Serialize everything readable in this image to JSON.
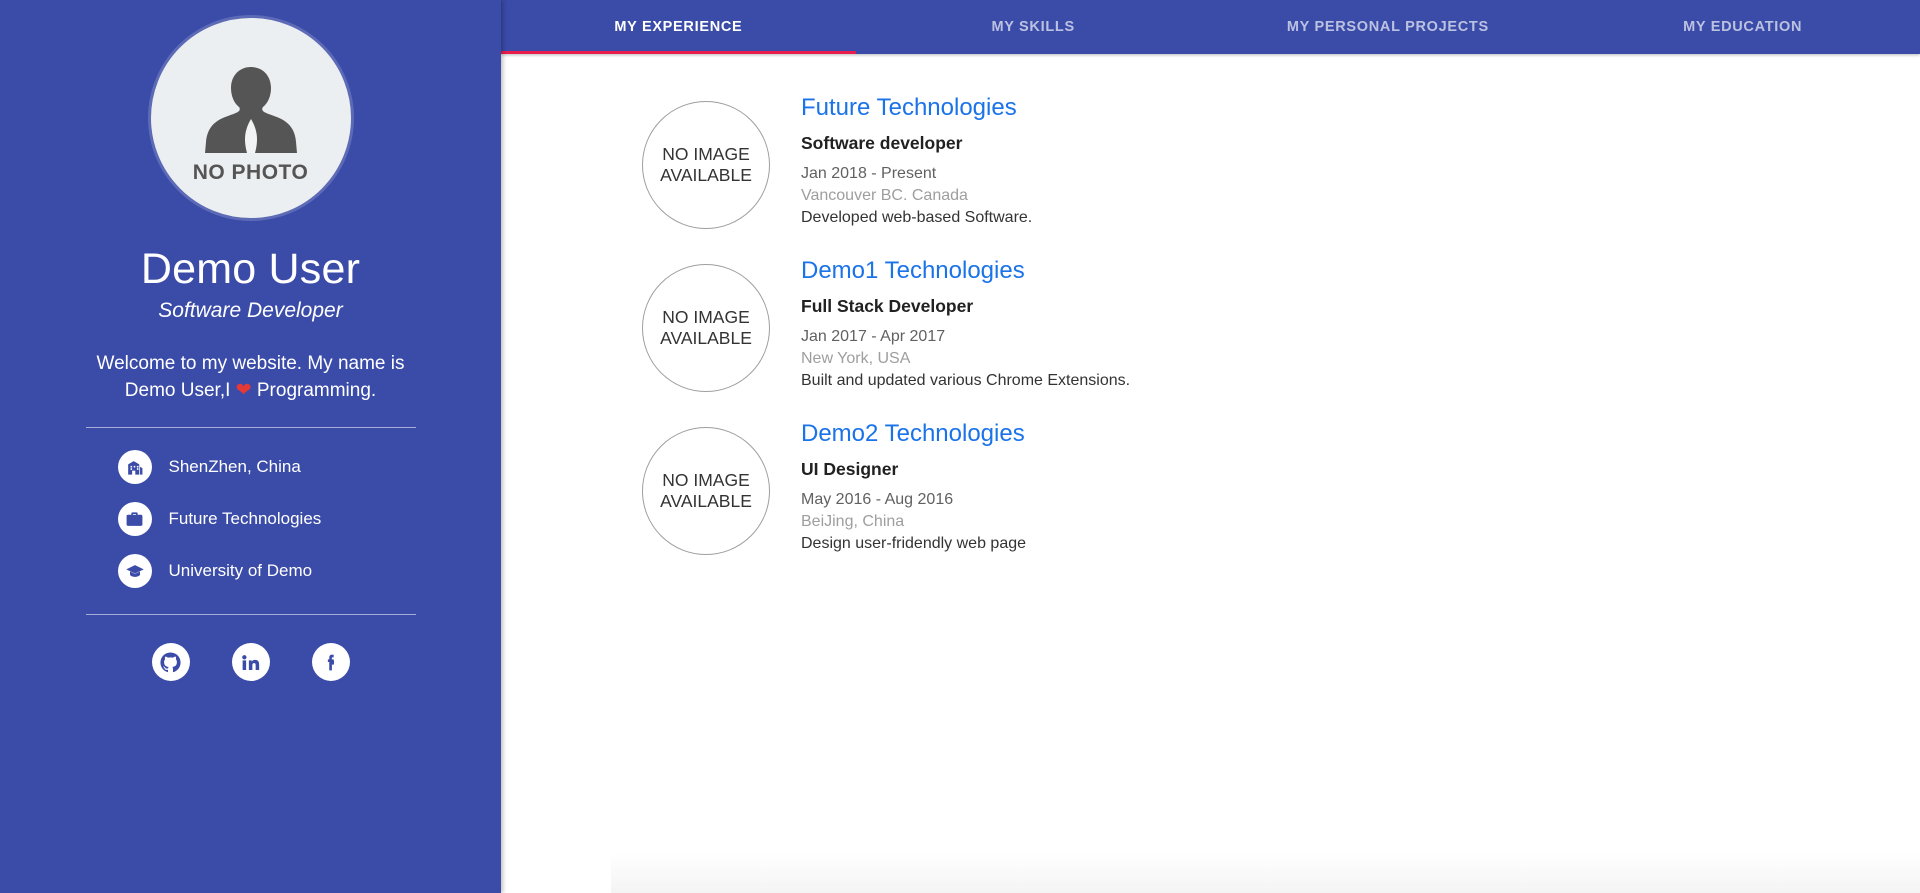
{
  "sidebar": {
    "avatar": {
      "placeholder_text": "NO PHOTO",
      "icon": "person-silhouette-icon"
    },
    "name": "Demo User",
    "role": "Software Developer",
    "bio_line1": "Welcome to my website. My name is",
    "bio_line2_before": "Demo User,I ",
    "bio_heart": "❤",
    "bio_line2_after": " Programming.",
    "info_items": [
      {
        "icon": "city-building-icon",
        "label": "ShenZhen, China"
      },
      {
        "icon": "briefcase-icon",
        "label": "Future Technologies"
      },
      {
        "icon": "graduation-cap-icon",
        "label": "University of Demo"
      }
    ],
    "social_items": [
      {
        "icon": "github-icon",
        "name": "GitHub"
      },
      {
        "icon": "linkedin-icon",
        "name": "LinkedIn"
      },
      {
        "icon": "facebook-icon",
        "name": "Facebook"
      }
    ]
  },
  "tabs": [
    {
      "label": "MY EXPERIENCE",
      "active": true
    },
    {
      "label": "MY SKILLS",
      "active": false
    },
    {
      "label": "MY PERSONAL PROJECTS",
      "active": false
    },
    {
      "label": "MY EDUCATION",
      "active": false
    }
  ],
  "experience": [
    {
      "logo_line1": "NO IMAGE",
      "logo_line2": "AVAILABLE",
      "company": "Future Technologies",
      "title": "Software developer",
      "dates": "Jan 2018 - Present",
      "location": "Vancouver BC. Canada",
      "description": "Developed web-based Software."
    },
    {
      "logo_line1": "NO IMAGE",
      "logo_line2": "AVAILABLE",
      "company": "Demo1 Technologies",
      "title": "Full Stack Developer",
      "dates": "Jan 2017 - Apr 2017",
      "location": "New York, USA",
      "description": "Built and updated various Chrome Extensions."
    },
    {
      "logo_line1": "NO IMAGE",
      "logo_line2": "AVAILABLE",
      "company": "Demo2 Technologies",
      "title": "UI Designer",
      "dates": "May 2016 - Aug 2016",
      "location": "BeiJing, China",
      "description": "Design user-fridendly web page"
    }
  ],
  "colors": {
    "sidebar_bg": "#3a4ba8",
    "tabbar_bg": "#3a4ba8",
    "active_tab_underline": "#e91e4e",
    "link_blue": "#1a73e8",
    "heart_red": "#e53935"
  }
}
